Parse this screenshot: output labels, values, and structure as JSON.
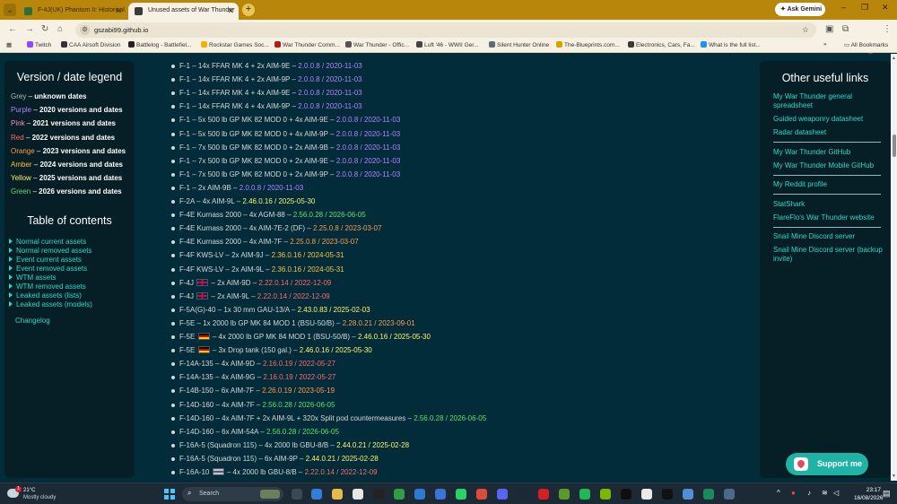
{
  "browser": {
    "tabs": [
      {
        "title": "F-4J(UK) Phantom II: Historical",
        "active": false,
        "favicon_color": "#2a6f3a"
      },
      {
        "title": "Unused assets of War Thunder",
        "active": true,
        "favicon_color": "#3b3b3b"
      }
    ],
    "new_tab": "+",
    "gemini_label": "Ask Gemini",
    "window_controls": {
      "minimize": "–",
      "restore": "❐",
      "close": "✕"
    },
    "url": "gszabi99.github.io",
    "bookmarks": [
      {
        "label": "Twitch",
        "color": "#9146ff"
      },
      {
        "label": "CAA Airsoft Division",
        "color": "#333333"
      },
      {
        "label": "Battlelog - Battlefiel...",
        "color": "#222222"
      },
      {
        "label": "Rockstar Games Soc...",
        "color": "#f0b400"
      },
      {
        "label": "War Thunder Comm...",
        "color": "#b11d1d"
      },
      {
        "label": "War Thunder - Offic...",
        "color": "#555555"
      },
      {
        "label": "Luft '46 - WWII Ger...",
        "color": "#444444"
      },
      {
        "label": "Silent Hunter Online",
        "color": "#5a6e7a"
      },
      {
        "label": "The-Blueprints.com...",
        "color": "#d9a400"
      },
      {
        "label": "Electronics, Cars, Fa...",
        "color": "#3a3a3a"
      },
      {
        "label": "What is the full list...",
        "color": "#1e90ff"
      }
    ],
    "all_bookmarks": "All Bookmarks"
  },
  "left_panel": {
    "legend_title": "Version / date legend",
    "legend": [
      {
        "name": "Grey",
        "desc": "unknown dates",
        "color": "#b8b8b8"
      },
      {
        "name": "Purple",
        "desc": "2020 versions and dates",
        "color": "#b084ff"
      },
      {
        "name": "Pink",
        "desc": "2021 versions and dates",
        "color": "#ff8fd0"
      },
      {
        "name": "Red",
        "desc": "2022 versions and dates",
        "color": "#ff6a6a"
      },
      {
        "name": "Orange",
        "desc": "2023 versions and dates",
        "color": "#ff9b4a"
      },
      {
        "name": "Amber",
        "desc": "2024 versions and dates",
        "color": "#ffc23d"
      },
      {
        "name": "Yellow",
        "desc": "2025 versions and dates",
        "color": "#fff46a"
      },
      {
        "name": "Green",
        "desc": "2026 versions and dates",
        "color": "#5fe06a"
      }
    ],
    "toc_title": "Table of contents",
    "toc": [
      "Normal current assets",
      "Normal removed assets",
      "Event current assets",
      "Event removed assets",
      "WTM assets",
      "WTM removed assets",
      "Leaked assets (lists)",
      "Leaked assets (models)"
    ],
    "changelog": "Changelog"
  },
  "entries": [
    {
      "name": "F-1 – 14x FFAR MK 4 + 2x AIM-9E",
      "flag": "",
      "suffix": "",
      "version": "2.0.0.8 / 2020-11-03",
      "color": "#b084ff"
    },
    {
      "name": "F-1 – 14x FFAR MK 4 + 2x AIM-9P",
      "flag": "",
      "suffix": "",
      "version": "2.0.0.8 / 2020-11-03",
      "color": "#b084ff"
    },
    {
      "name": "F-1 – 14x FFAR MK 4 + 4x AIM-9E",
      "flag": "",
      "suffix": "",
      "version": "2.0.0.8 / 2020-11-03",
      "color": "#b084ff"
    },
    {
      "name": "F-1 – 14x FFAR MK 4 + 4x AIM-9P",
      "flag": "",
      "suffix": "",
      "version": "2.0.0.8 / 2020-11-03",
      "color": "#b084ff"
    },
    {
      "name": "F-1 – 5x 500 lb GP MK 82 MOD 0 + 4x AIM-9E",
      "flag": "",
      "suffix": "",
      "version": "2.0.0.8 / 2020-11-03",
      "color": "#b084ff"
    },
    {
      "name": "F-1 – 5x 500 lb GP MK 82 MOD 0 + 4x AIM-9P",
      "flag": "",
      "suffix": "",
      "version": "2.0.0.8 / 2020-11-03",
      "color": "#b084ff"
    },
    {
      "name": "F-1 – 7x 500 lb GP MK 82 MOD 0 + 2x AIM-9B",
      "flag": "",
      "suffix": "",
      "version": "2.0.0.8 / 2020-11-03",
      "color": "#b084ff"
    },
    {
      "name": "F-1 – 7x 500 lb GP MK 82 MOD 0 + 2x AIM-9E",
      "flag": "",
      "suffix": "",
      "version": "2.0.0.8 / 2020-11-03",
      "color": "#b084ff"
    },
    {
      "name": "F-1 – 7x 500 lb GP MK 82 MOD 0 + 2x AIM-9P",
      "flag": "",
      "suffix": "",
      "version": "2.0.0.8 / 2020-11-03",
      "color": "#b084ff"
    },
    {
      "name": "F-1 – 2x AIM-9B",
      "flag": "",
      "suffix": "",
      "version": "2.0.0.8 / 2020-11-03",
      "color": "#b084ff"
    },
    {
      "name": "F-2A – 4x AIM-9L",
      "flag": "",
      "suffix": "",
      "version": "2.46.0.16 / 2025-05-30",
      "color": "#fff46a"
    },
    {
      "name": "F-4E Kurnass 2000 – 4x AGM-88",
      "flag": "",
      "suffix": "",
      "version": "2.56.0.28 / 2026-06-05",
      "color": "#5fe06a"
    },
    {
      "name": "F-4E Kurnass 2000 – 4x AIM-7E-2 (DF)",
      "flag": "",
      "suffix": "",
      "version": "2.25.0.8 / 2023-03-07",
      "color": "#ff9b4a"
    },
    {
      "name": "F-4E Kurnass 2000 – 4x AIM-7F",
      "flag": "",
      "suffix": "",
      "version": "2.25.0.8 / 2023-03-07",
      "color": "#ff9b4a"
    },
    {
      "name": "F-4F KWS-LV – 2x AIM-9J",
      "flag": "",
      "suffix": "",
      "version": "2.36.0.16 / 2024-05-31",
      "color": "#ffc23d"
    },
    {
      "name": "F-4F KWS-LV – 2x AIM-9L",
      "flag": "",
      "suffix": "",
      "version": "2.36.0.16 / 2024-05-31",
      "color": "#ffc23d"
    },
    {
      "name": "F-4J",
      "flag": "uk",
      "suffix": "– 2x AIM-9D",
      "version": "2.22.0.14 / 2022-12-09",
      "color": "#ff6a6a"
    },
    {
      "name": "F-4J",
      "flag": "uk",
      "suffix": "– 2x AIM-9L",
      "version": "2.22.0.14 / 2022-12-09",
      "color": "#ff6a6a"
    },
    {
      "name": "F-5A(G)-40 – 1x 30 mm GAU-13/A",
      "flag": "",
      "suffix": "",
      "version": "2.43.0.83 / 2025-02-03",
      "color": "#fff46a"
    },
    {
      "name": "F-5E – 1x 2000 lb GP MK 84 MOD 1 (BSU-50/B)",
      "flag": "",
      "suffix": "",
      "version": "2.28.0.21 / 2023-09-01",
      "color": "#ff9b4a"
    },
    {
      "name": "F-5E",
      "flag": "de",
      "suffix": "– 4x 2000 lb GP MK 84 MOD 1 (BSU-50/B)",
      "version": "2.46.0.16 / 2025-05-30",
      "color": "#fff46a"
    },
    {
      "name": "F-5E",
      "flag": "de",
      "suffix": "– 3x Drop tank (150 gal.)",
      "version": "2.46.0.16 / 2025-05-30",
      "color": "#fff46a"
    },
    {
      "name": "F-14A-135 – 4x AIM-9D",
      "flag": "",
      "suffix": "",
      "version": "2.16.0.19 / 2022-05-27",
      "color": "#ff6a6a"
    },
    {
      "name": "F-14A-135 – 4x AIM-9G",
      "flag": "",
      "suffix": "",
      "version": "2.16.0.19 / 2022-05-27",
      "color": "#ff6a6a"
    },
    {
      "name": "F-14B-150 – 6x AIM-7F",
      "flag": "",
      "suffix": "",
      "version": "2.26.0.19 / 2023-05-19",
      "color": "#ff9b4a"
    },
    {
      "name": "F-14D-160 – 4x AIM-7F",
      "flag": "",
      "suffix": "",
      "version": "2.56.0.28 / 2026-06-05",
      "color": "#5fe06a"
    },
    {
      "name": "F-14D-160 – 4x AIM-7F + 2x AIM-9L + 320x Split pod countermeasures",
      "flag": "",
      "suffix": "",
      "version": "2.56.0.28 / 2026-06-05",
      "color": "#5fe06a"
    },
    {
      "name": "F-14D-160 – 6x AIM-54A",
      "flag": "",
      "suffix": "",
      "version": "2.56.0.28 / 2026-06-05",
      "color": "#5fe06a"
    },
    {
      "name": "F-16A-5 (Squadron 115) – 4x 2000 lb GBU-8/B",
      "flag": "",
      "suffix": "",
      "version": "2.44.0.21 / 2025-02-28",
      "color": "#fff46a"
    },
    {
      "name": "F-16A-5 (Squadron 115) – 6x AIM-9P",
      "flag": "",
      "suffix": "",
      "version": "2.44.0.21 / 2025-02-28",
      "color": "#fff46a"
    },
    {
      "name": "F-16A-10",
      "flag": "gr",
      "suffix": "– 4x 2000 lb GBU-8/B",
      "version": "2.22.0.14 / 2022-12-09",
      "color": "#ff6a6a"
    }
  ],
  "right_panel": {
    "title": "Other useful links",
    "links": [
      "My War Thunder general spreadsheet",
      "Guided weaponry datasheet",
      "Radar datasheet",
      "My War Thunder GitHub",
      "My War Thunder Mobile GitHub",
      "My Reddit profile",
      "StatShark",
      "FlareFlo's War Thunder website",
      "Snail Mine Discord server",
      "Snail Mine Discord server (backup invite)"
    ]
  },
  "support_button": "Support me",
  "taskbar": {
    "weather_temp": "21°C",
    "weather_desc": "Mostly cloudy",
    "weather_badge": "1",
    "search_label": "Search",
    "time": "23:17",
    "date": "16/08/2026"
  }
}
